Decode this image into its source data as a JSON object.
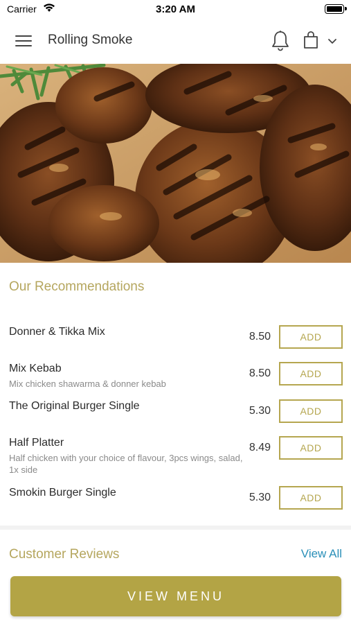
{
  "status_bar": {
    "carrier": "Carrier",
    "time": "3:20 AM"
  },
  "header": {
    "title": "Rolling Smoke",
    "icons": [
      "menu-icon",
      "bell-icon",
      "shopping-bag-icon",
      "chevron-down-icon"
    ]
  },
  "hero": {
    "image": "grilled chicken pieces"
  },
  "recommendations": {
    "title": "Our Recommendations",
    "items": [
      {
        "name": "Donner & Tikka Mix",
        "description": "",
        "price": "8.50",
        "action": "ADD"
      },
      {
        "name": "Mix Kebab",
        "description": "Mix chicken shawarma & donner kebab",
        "price": "8.50",
        "action": "ADD"
      },
      {
        "name": "The Original Burger Single",
        "description": "",
        "price": "5.30",
        "action": "ADD"
      },
      {
        "name": "Half Platter",
        "description": "Half chicken with your choice of flavour, 3pcs wings, salad, 1x side",
        "price": "8.49",
        "action": "ADD"
      },
      {
        "name": "Smokin Burger Single",
        "description": "",
        "price": "5.30",
        "action": "ADD"
      }
    ]
  },
  "reviews": {
    "title": "Customer Reviews",
    "view_all": "View All"
  },
  "footer": {
    "view_menu": "VIEW MENU"
  },
  "colors": {
    "accent": "#b3a445",
    "link": "#2a8fb8",
    "section_title": "#b5a65e"
  }
}
